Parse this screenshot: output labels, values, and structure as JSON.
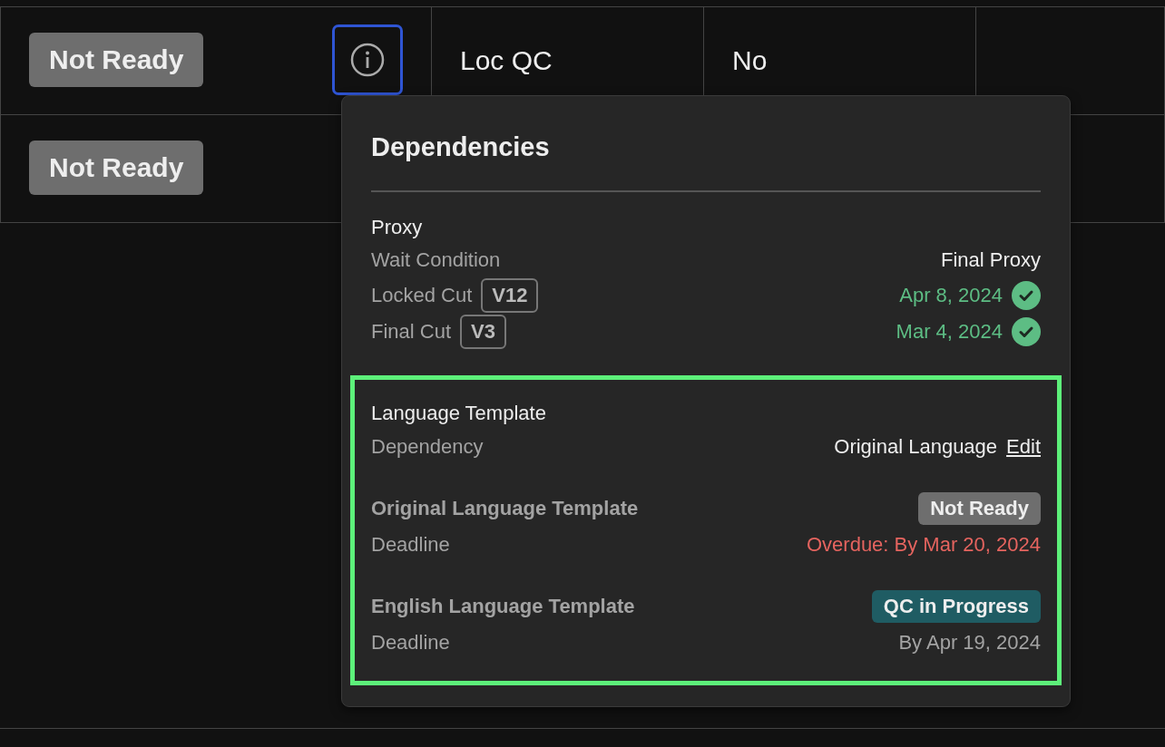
{
  "table": {
    "rows": [
      {
        "status": "Not Ready",
        "info_button": {
          "focused": true
        },
        "column_3": "Loc QC",
        "column_4": "No"
      },
      {
        "status": "Not Ready"
      }
    ]
  },
  "popover": {
    "title": "Dependencies",
    "sections": [
      {
        "title": "Proxy",
        "highlighted": false,
        "rows": [
          {
            "label": "Wait Condition",
            "value": "Final Proxy"
          },
          {
            "label": "Locked Cut",
            "tag": "V12",
            "value": "Apr 8, 2024",
            "done": true
          },
          {
            "label": "Final Cut",
            "tag": "V3",
            "value": "Mar 4, 2024",
            "done": true
          }
        ]
      },
      {
        "title": "Language Template",
        "highlighted": true,
        "rows": [
          {
            "label": "Dependency",
            "value": "Original Language",
            "link": "Edit"
          }
        ],
        "items": [
          {
            "name": "Original Language Template",
            "status": {
              "text": "Not Ready",
              "kind": "not_ready"
            },
            "label": "Deadline",
            "deadline": "Overdue: By Mar 20, 2024",
            "overdue": true
          },
          {
            "name": "English Language Template",
            "status": {
              "text": "QC in Progress",
              "kind": "qc"
            },
            "label": "Deadline",
            "deadline": "By Apr 19, 2024",
            "overdue": false
          }
        ]
      }
    ]
  }
}
